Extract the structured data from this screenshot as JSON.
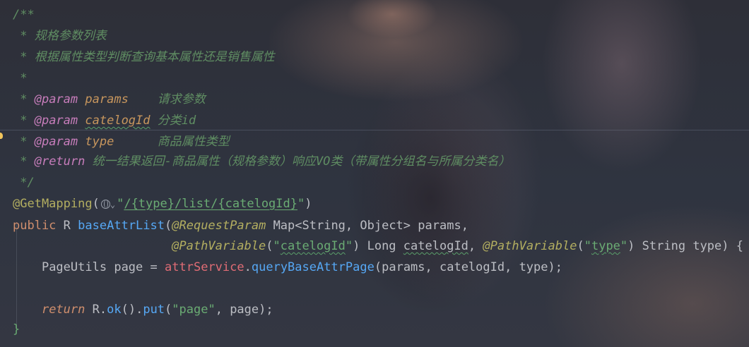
{
  "editor": {
    "javadoc": {
      "open": "/**",
      "desc1": " * 规格参数列表",
      "desc2": " * 根据属性类型判断查询基本属性还是销售属性",
      "blank": " *",
      "star": " * ",
      "param_tag": "@param",
      "return_tag": "@return",
      "p1_name": "params",
      "p1_desc": "请求参数",
      "p2_name": "catelogId",
      "p2_desc": "分类id",
      "p3_name": "type",
      "p3_desc": "商品属性类型",
      "return_desc": "统一结果返回-商品属性（规格参数）响应VO类（带属性分组名与所属分类名）",
      "close": " */"
    },
    "mapping": {
      "annotation": "@GetMapping",
      "open_paren": "(",
      "path_quote_open": "\"",
      "path_segments": [
        "/{type}",
        "/list/",
        "{catelogId}"
      ],
      "path_quote_close": "\"",
      "close_paren": ")"
    },
    "signature": {
      "kw_public": "public",
      "return_type": "R",
      "method": "baseAttrList",
      "open": "(",
      "ann_request_param": "@RequestParam",
      "param1_type": "Map<String, Object>",
      "param1_name": "params",
      "comma": ",",
      "ann_path_variable": "@PathVariable",
      "pv1_value": "catelogId",
      "long_type": "Long",
      "pv1_name": "catelogId",
      "pv2_value": "type",
      "string_type": "String",
      "pv2_name": "type",
      "close_brace": ") {"
    },
    "body": {
      "local_type": "PageUtils",
      "local_name": "page",
      "assign": "=",
      "service": "attrService",
      "service_call": "queryBaseAttrPage",
      "call_args": "(params, catelogId, type);",
      "kw_return": "return",
      "ret_obj": "R",
      "ok": "ok",
      "put": "put",
      "put_key": "\"page\"",
      "put_val": ", page);",
      "closing": "}"
    }
  }
}
